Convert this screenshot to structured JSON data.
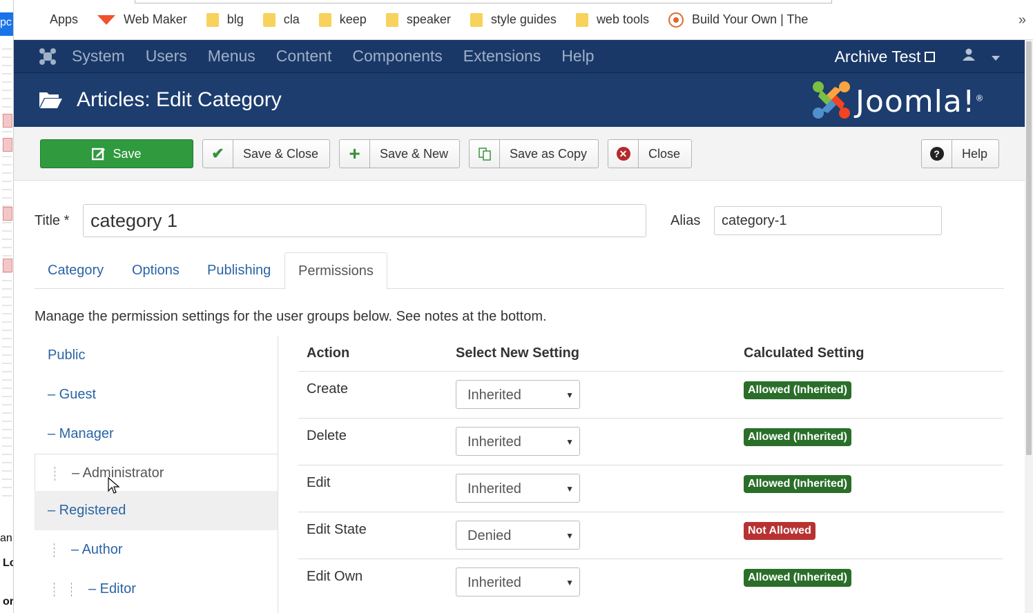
{
  "bookmarks": {
    "items": [
      {
        "label": "Apps",
        "icon": "apps-grid-icon"
      },
      {
        "label": "Web Maker",
        "icon": "webmaker-icon"
      },
      {
        "label": "blg",
        "icon": "folder-icon"
      },
      {
        "label": "cla",
        "icon": "folder-icon"
      },
      {
        "label": "keep",
        "icon": "folder-icon"
      },
      {
        "label": "speaker",
        "icon": "folder-icon"
      },
      {
        "label": "style guides",
        "icon": "folder-icon"
      },
      {
        "label": "web tools",
        "icon": "folder-icon"
      },
      {
        "label": "Build Your Own | The",
        "icon": "build-icon"
      }
    ],
    "more": "»"
  },
  "leftstrip": {
    "top_text": "pc",
    "an_text": "an",
    "lo_text": "Lo",
    "or_text": "or"
  },
  "nav": {
    "items": [
      "System",
      "Users",
      "Menus",
      "Content",
      "Components",
      "Extensions",
      "Help"
    ],
    "site_name": "Archive Test"
  },
  "header": {
    "title": "Articles: Edit Category",
    "logo_text": "Joomla!",
    "logo_mark": "®"
  },
  "toolbar": {
    "save": "Save",
    "save_close": "Save & Close",
    "save_new": "Save & New",
    "save_copy": "Save as Copy",
    "close": "Close",
    "help": "Help"
  },
  "form": {
    "title_label": "Title *",
    "title_value": "category 1",
    "alias_label": "Alias",
    "alias_value": "category-1"
  },
  "tabs": [
    "Category",
    "Options",
    "Publishing",
    "Permissions"
  ],
  "active_tab": "Permissions",
  "permissions": {
    "note": "Manage the permission settings for the user groups below. See notes at the bottom.",
    "groups": [
      "Public",
      "– Guest",
      "– Manager",
      "– Administrator",
      "– Registered",
      "– Author",
      "– Editor"
    ],
    "selected_group": "– Administrator",
    "headers": {
      "action": "Action",
      "setting": "Select New Setting",
      "calculated": "Calculated Setting"
    },
    "rows": [
      {
        "action": "Create",
        "setting": "Inherited",
        "calculated": "Allowed (Inherited)"
      },
      {
        "action": "Delete",
        "setting": "Inherited",
        "calculated": "Allowed (Inherited)"
      },
      {
        "action": "Edit",
        "setting": "Inherited",
        "calculated": "Allowed (Inherited)"
      },
      {
        "action": "Edit State",
        "setting": "Denied",
        "calculated": "Not Allowed"
      },
      {
        "action": "Edit Own",
        "setting": "Inherited",
        "calculated": "Allowed (Inherited)"
      }
    ]
  },
  "colors": {
    "nav_bg": "#1a3867",
    "header_bg": "#1c3d6e",
    "save_green": "#2f9a3e",
    "allowed_badge": "#2a6e2a",
    "denied_badge": "#b83232",
    "link_blue": "#2a64a4"
  }
}
